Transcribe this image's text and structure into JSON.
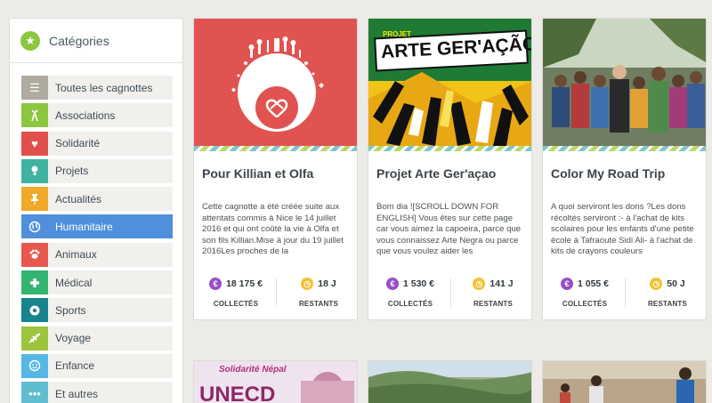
{
  "sidebar": {
    "title": "Catégories",
    "items": [
      {
        "label": "Toutes les cagnottes",
        "color": "#b0aba0",
        "icon": "list-icon"
      },
      {
        "label": "Associations",
        "color": "#8cc63f",
        "icon": "ribbon-icon"
      },
      {
        "label": "Solidarité",
        "color": "#e0504a",
        "icon": "heart-icon"
      },
      {
        "label": "Projets",
        "color": "#3fb39f",
        "icon": "lightbulb-icon"
      },
      {
        "label": "Actualités",
        "color": "#f1a92a",
        "icon": "pin-icon"
      },
      {
        "label": "Humanitaire",
        "color": "#4f8fdc",
        "icon": "globe-icon"
      },
      {
        "label": "Animaux",
        "color": "#e8574e",
        "icon": "paw-icon"
      },
      {
        "label": "Médical",
        "color": "#33b470",
        "icon": "medical-cross-icon"
      },
      {
        "label": "Sports",
        "color": "#17838d",
        "icon": "ball-icon"
      },
      {
        "label": "Voyage",
        "color": "#9cc43d",
        "icon": "plane-icon"
      },
      {
        "label": "Enfance",
        "color": "#56b7e4",
        "icon": "child-icon"
      },
      {
        "label": "Et autres",
        "color": "#5fbdd0",
        "icon": "dots-icon"
      }
    ]
  },
  "stats_labels": {
    "collected": "COLLECTÉS",
    "remaining": "RESTANTS"
  },
  "cards": [
    {
      "title": "Pour Killian et Olfa",
      "description": "Cette cagnotte a été créée suite aux attentats commis à Nice le 14 juillet 2016 et qui ont coûté la vie à Olfa et son fils Killian.Mise à jour du 19 juillet 2016Les proches de la",
      "amount": "18 175 €",
      "days": "18 J"
    },
    {
      "title": "Projet Arte Ger'açao",
      "description": "Bom dia ![SCROLL DOWN FOR ENGLISH] Vous êtes sur cette page car vous aimez la capoeira, parce que vous connaissez Arte Negra ou parce que vous voulez aider les",
      "amount": "1 530 €",
      "days": "141 J",
      "image_text": {
        "small": "PROJET",
        "big": "ARTE GER'AÇÃO"
      }
    },
    {
      "title": "Color My Road Trip",
      "description": "A quoi serviront les dons ?Les dons récoltés serviront :- à l'achat de kits scolaires pour les enfants d'une petite école à Tafraoute Sidi Ali- à l'achat de kits de crayons couleurs",
      "amount": "1 055 €",
      "days": "50 J"
    }
  ],
  "bottom_cards": [
    {
      "image_text": {
        "top": "Solidarité Népal",
        "big": "UNECD"
      }
    },
    {
      "image_text": {}
    },
    {
      "image_text": {}
    }
  ]
}
